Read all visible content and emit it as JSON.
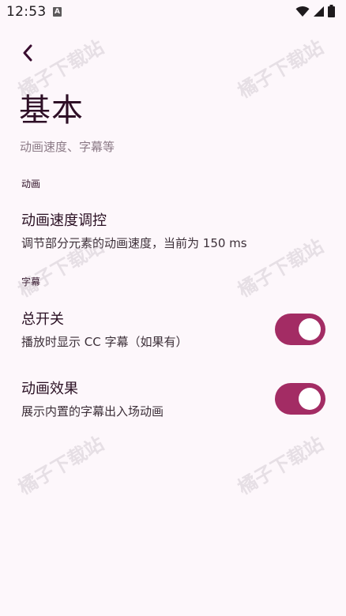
{
  "status_bar": {
    "time": "12:53",
    "notification_icon": "a-icon",
    "icons": [
      "wifi-icon",
      "signal-icon",
      "battery-icon"
    ]
  },
  "header": {
    "back_icon": "chevron-left-icon",
    "title": "基本",
    "subtitle": "动画速度、字幕等"
  },
  "sections": [
    {
      "header": "动画",
      "items": [
        {
          "title": "动画速度调控",
          "summary": "调节部分元素的动画速度，当前为 150 ms"
        }
      ]
    },
    {
      "header": "字幕",
      "items": [
        {
          "title": "总开关",
          "summary": "播放时显示 CC 字幕（如果有）",
          "switch_on": true
        },
        {
          "title": "动画效果",
          "summary": "展示内置的字幕出入场动画",
          "switch_on": true
        }
      ]
    }
  ],
  "watermark": {
    "text": "橘子下载站"
  },
  "colors": {
    "background": "#fdf7fb",
    "accent": "#a32c64",
    "title": "#2e0f26",
    "subtitle": "#8b7a86"
  }
}
